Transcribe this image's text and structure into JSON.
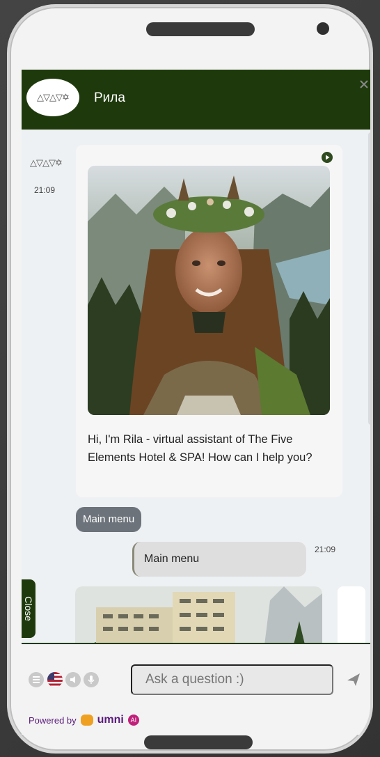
{
  "header": {
    "logo_text": "△▽△▽✡",
    "title": "Рила"
  },
  "messages": {
    "bot_symbol": "△▽△▽✡",
    "bot_time": "21:09",
    "bot_text": "Hi, I'm Rila - virtual assistant of The Five Elements Hotel & SPA! How can I help you?",
    "quick_reply": "Main menu",
    "user_text": "Main menu",
    "user_time": "21:09"
  },
  "side_tab": {
    "label": "Close"
  },
  "composer": {
    "placeholder": "Ask a question :)"
  },
  "footer": {
    "powered_by": "Powered by",
    "brand": "umni",
    "ai_badge": "AI"
  },
  "colors": {
    "brand_green": "#1e3a0c",
    "chip_gray": "#6c737a",
    "brand_purple": "#5a1a7a"
  },
  "icons": [
    "close-icon",
    "play-icon",
    "menu-icon",
    "us-flag-icon",
    "speaker-icon",
    "microphone-icon",
    "send-icon"
  ]
}
